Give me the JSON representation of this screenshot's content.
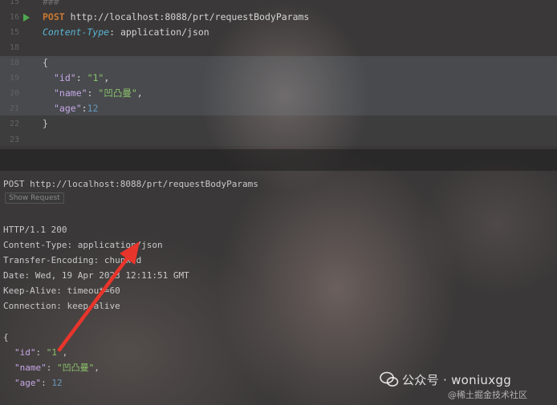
{
  "editor": {
    "lines": [
      {
        "num": "15",
        "text": "###"
      },
      {
        "num": "16",
        "method": "POST",
        "url": "http://localhost:8088/prt/requestBodyParams"
      },
      {
        "num": "15",
        "header_name": "Content-Type",
        "header_value": "application/json"
      },
      {
        "num": "18"
      },
      {
        "num": "18",
        "text": "{"
      },
      {
        "num": "19",
        "key": "\"id\"",
        "value": "\"1\""
      },
      {
        "num": "20",
        "key": "\"name\"",
        "value": "\"凹凸曼\""
      },
      {
        "num": "21",
        "key": "\"age\"",
        "value": "12"
      },
      {
        "num": "22",
        "text": "}"
      },
      {
        "num": "23"
      }
    ]
  },
  "response": {
    "request_line": "POST http://localhost:8088/prt/requestBodyParams",
    "show_request_label": "Show Request",
    "status": "HTTP/1.1 200",
    "headers": [
      "Content-Type: application/json",
      "Transfer-Encoding: chunked",
      "Date: Wed, 19 Apr 2023 12:11:51 GMT",
      "Keep-Alive: timeout=60",
      "Connection: keep-alive"
    ],
    "body_open": "{",
    "body": [
      {
        "key": "\"id\"",
        "value": "\"1\""
      },
      {
        "key": "\"name\"",
        "value": "\"凹凸曼\""
      },
      {
        "key": "\"age\"",
        "value": "12"
      }
    ]
  },
  "watermark": {
    "title": "公众号 · woniuxgg",
    "subtitle": "@稀土掘金技术社区"
  },
  "colors": {
    "arrow": "#e8352b",
    "run_icon": "#4fa84f"
  }
}
